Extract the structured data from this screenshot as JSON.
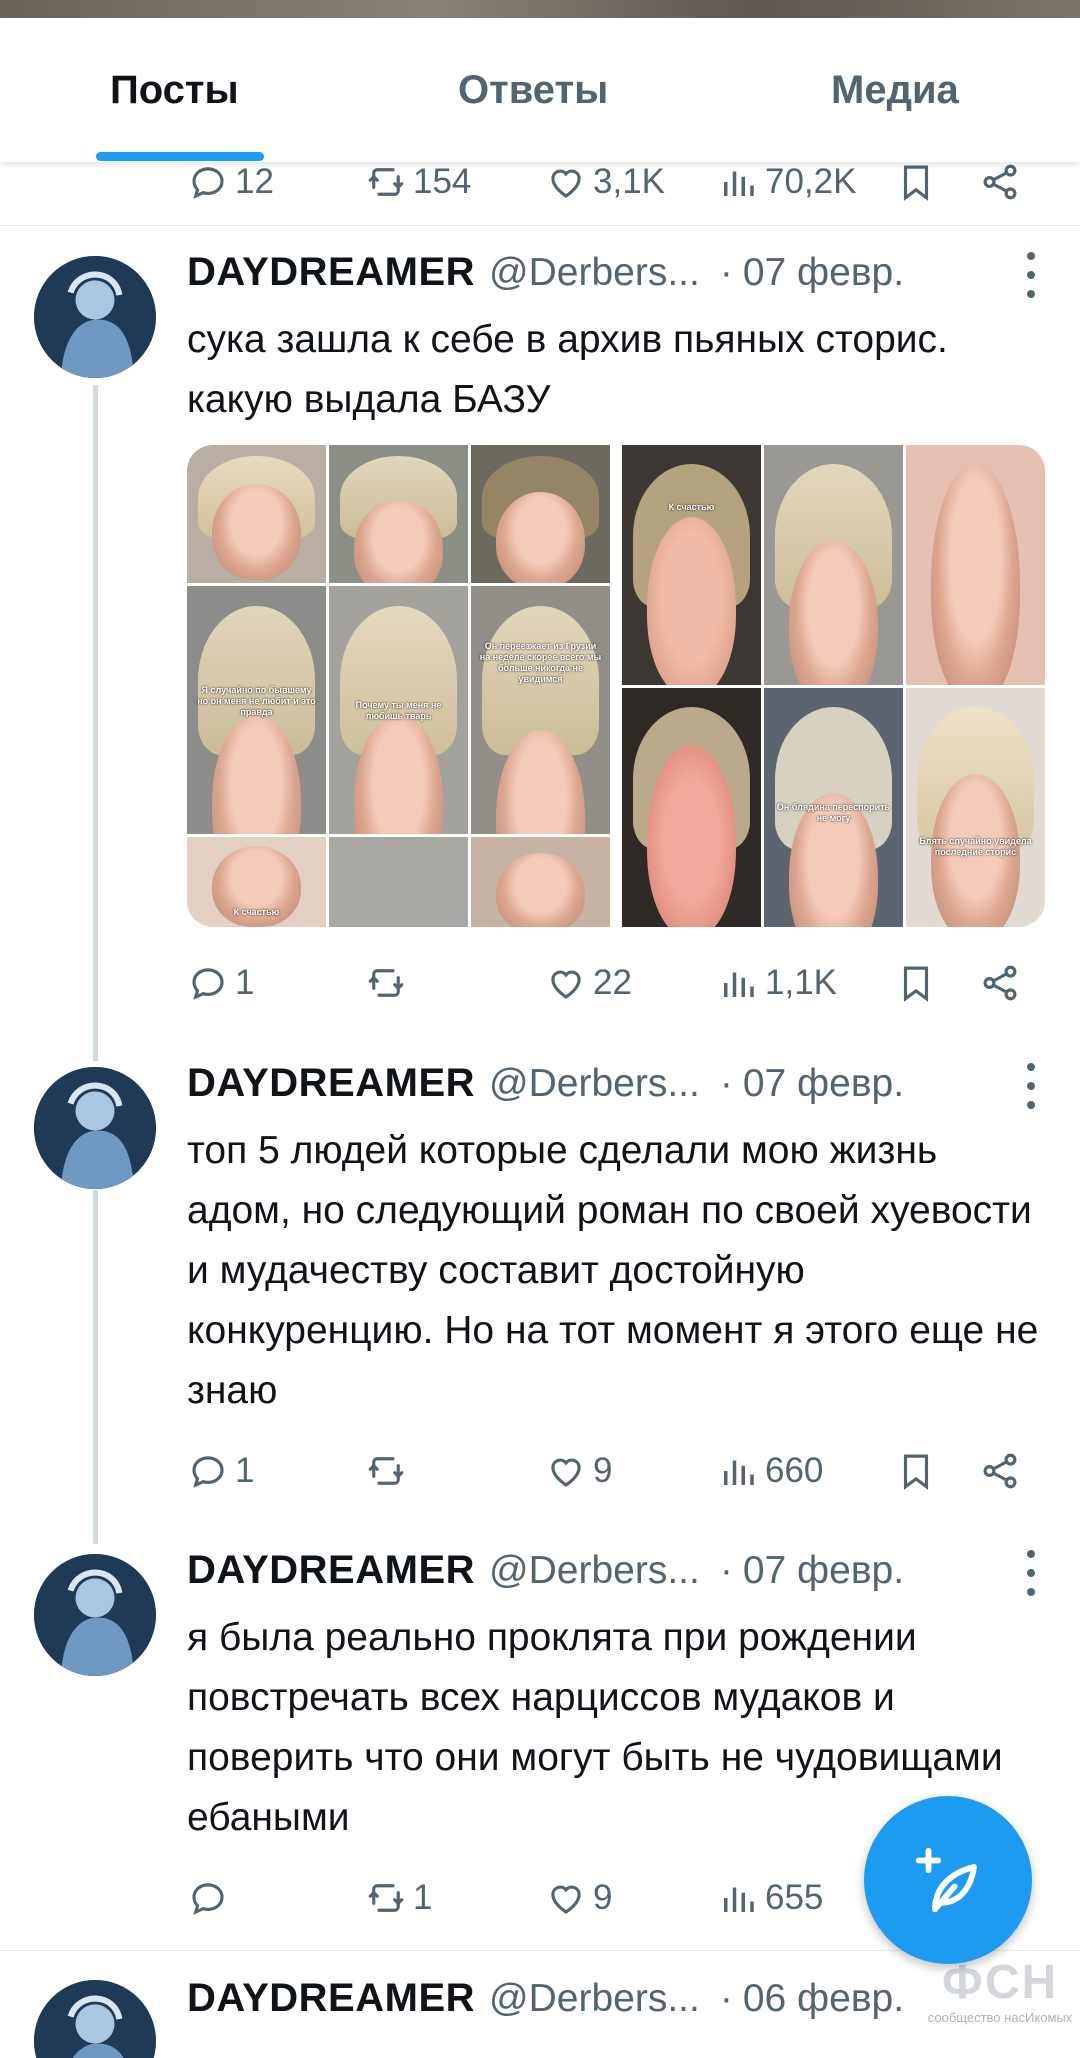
{
  "tabs": [
    {
      "label": "Посты",
      "active": true
    },
    {
      "label": "Ответы",
      "active": false
    },
    {
      "label": "Медиа",
      "active": false
    }
  ],
  "prev_tweet_stats": {
    "replies": "12",
    "retweets": "154",
    "likes": "3,1K",
    "views": "70,2K"
  },
  "tweets": [
    {
      "name": "DAYDREAMER",
      "handle": "@Derbers...",
      "dot": "·",
      "date": "07 февр.",
      "text": "сука зашла к себе в архив пьяных сторис. какую выдала БАЗУ",
      "has_media": true,
      "media_captions": {
        "left_mid_1": "Я случайно по бывшему но он меня не любит и это правда",
        "left_mid_2": "Почему ты меня не любишь тварь",
        "left_mid_3": "Он переезжает из Грузии на неделе скорее всего мы больше никогда не увидимся",
        "left_bottom_1": "К счастью",
        "right_top_1": "К счастью",
        "right_bottom_2": "Он блядина переспорить не могу",
        "right_bottom_3": "Блять случайно увидела последние сторис"
      },
      "stats": {
        "replies": "1",
        "retweets": "",
        "likes": "22",
        "views": "1,1K"
      }
    },
    {
      "name": "DAYDREAMER",
      "handle": "@Derbers...",
      "dot": "·",
      "date": "07 февр.",
      "text": "топ 5 людей которые сделали мою жизнь адом, но следующий роман по своей хуевости и мудачеству составит достойную конкуренцию. Но на тот момент я этого еще не знаю",
      "has_media": false,
      "stats": {
        "replies": "1",
        "retweets": "",
        "likes": "9",
        "views": "660"
      }
    },
    {
      "name": "DAYDREAMER",
      "handle": "@Derbers...",
      "dot": "·",
      "date": "07 февр.",
      "text": "я была реально проклята при рождении повстречать всех нарциссов мудаков и поверить что они могут быть не чудовищами ебаными",
      "has_media": false,
      "stats": {
        "replies": "",
        "retweets": "1",
        "likes": "9",
        "views": "655"
      }
    },
    {
      "name": "DAYDREAMER",
      "handle": "@Derbers...",
      "dot": "·",
      "date": "06 февр."
    }
  ],
  "watermark": {
    "logo": "ФСН",
    "text": "сообщество насИкомых"
  },
  "colors": {
    "accent": "#1d9bf0",
    "text": "#0f1419",
    "muted": "#536471",
    "divider": "#e6ecf0"
  },
  "icons": [
    "reply-icon",
    "retweet-icon",
    "like-icon",
    "views-icon",
    "bookmark-icon",
    "share-icon",
    "more-icon",
    "compose-icon"
  ]
}
